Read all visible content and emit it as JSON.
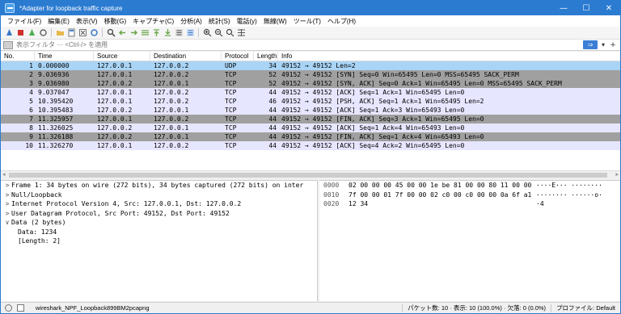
{
  "window": {
    "title": "*Adapter for loopback traffic capture",
    "minimize": "—",
    "maximize": "☐",
    "close": "✕"
  },
  "menu": [
    "ファイル(F)",
    "編集(E)",
    "表示(V)",
    "移動(G)",
    "キャプチャ(C)",
    "分析(A)",
    "統計(S)",
    "電話(y)",
    "無線(W)",
    "ツール(T)",
    "ヘルプ(H)"
  ],
  "filter": {
    "placeholder": "表示フィルタ ··· <Ctrl-/> を適用",
    "apply": "⇒",
    "dropdown": "▾",
    "add": "+"
  },
  "columns": [
    "No.",
    "Time",
    "Source",
    "Destination",
    "Protocol",
    "Length",
    "Info"
  ],
  "packets": [
    {
      "no": "1",
      "time": "0.000000",
      "src": "127.0.0.1",
      "dst": "127.0.0.2",
      "proto": "UDP",
      "len": "34",
      "info": "49152 → 49152 Len=2",
      "bg": "#a9d4f5"
    },
    {
      "no": "2",
      "time": "9.036936",
      "src": "127.0.0.1",
      "dst": "127.0.0.2",
      "proto": "TCP",
      "len": "52",
      "info": "49152 → 49152 [SYN] Seq=0 Win=65495 Len=0 MSS=65495 SACK_PERM",
      "bg": "#a0a0a0"
    },
    {
      "no": "3",
      "time": "9.036980",
      "src": "127.0.0.2",
      "dst": "127.0.0.1",
      "proto": "TCP",
      "len": "52",
      "info": "49152 → 49152 [SYN, ACK] Seq=0 Ack=1 Win=65495 Len=0 MSS=65495 SACK_PERM",
      "bg": "#a0a0a0"
    },
    {
      "no": "4",
      "time": "9.037047",
      "src": "127.0.0.1",
      "dst": "127.0.0.2",
      "proto": "TCP",
      "len": "44",
      "info": "49152 → 49152 [ACK] Seq=1 Ack=1 Win=65495 Len=0",
      "bg": "#e7e6ff"
    },
    {
      "no": "5",
      "time": "10.395420",
      "src": "127.0.0.1",
      "dst": "127.0.0.2",
      "proto": "TCP",
      "len": "46",
      "info": "49152 → 49152 [PSH, ACK] Seq=1 Ack=1 Win=65495 Len=2",
      "bg": "#e7e6ff"
    },
    {
      "no": "6",
      "time": "10.395483",
      "src": "127.0.0.2",
      "dst": "127.0.0.1",
      "proto": "TCP",
      "len": "44",
      "info": "49152 → 49152 [ACK] Seq=1 Ack=3 Win=65493 Len=0",
      "bg": "#e7e6ff"
    },
    {
      "no": "7",
      "time": "11.325957",
      "src": "127.0.0.1",
      "dst": "127.0.0.2",
      "proto": "TCP",
      "len": "44",
      "info": "49152 → 49152 [FIN, ACK] Seq=3 Ack=1 Win=65495 Len=0",
      "bg": "#a0a0a0"
    },
    {
      "no": "8",
      "time": "11.326025",
      "src": "127.0.0.2",
      "dst": "127.0.0.1",
      "proto": "TCP",
      "len": "44",
      "info": "49152 → 49152 [ACK] Seq=1 Ack=4 Win=65493 Len=0",
      "bg": "#e7e6ff"
    },
    {
      "no": "9",
      "time": "11.326188",
      "src": "127.0.0.2",
      "dst": "127.0.0.1",
      "proto": "TCP",
      "len": "44",
      "info": "49152 → 49152 [FIN, ACK] Seq=1 Ack=4 Win=65493 Len=0",
      "bg": "#a0a0a0"
    },
    {
      "no": "10",
      "time": "11.326270",
      "src": "127.0.0.1",
      "dst": "127.0.0.2",
      "proto": "TCP",
      "len": "44",
      "info": "49152 → 49152 [ACK] Seq=4 Ack=2 Win=65495 Len=0",
      "bg": "#e7e6ff"
    }
  ],
  "details": [
    {
      "expander": ">",
      "text": "Frame 1: 34 bytes on wire (272 bits), 34 bytes captured (272 bits) on inter",
      "indent": 0
    },
    {
      "expander": ">",
      "text": "Null/Loopback",
      "indent": 0
    },
    {
      "expander": ">",
      "text": "Internet Protocol Version 4, Src: 127.0.0.1, Dst: 127.0.0.2",
      "indent": 0
    },
    {
      "expander": ">",
      "text": "User Datagram Protocol, Src Port: 49152, Dst Port: 49152",
      "indent": 0
    },
    {
      "expander": "∨",
      "text": "Data (2 bytes)",
      "indent": 0
    },
    {
      "expander": "",
      "text": "Data: 1234",
      "indent": 1
    },
    {
      "expander": "",
      "text": "[Length: 2]",
      "indent": 1
    }
  ],
  "hex": [
    {
      "offset": "0000",
      "bytes": "02 00 00 00 45 00 00 1e  be 81 00 00 80 11 00 00",
      "ascii": "····E··· ········"
    },
    {
      "offset": "0010",
      "bytes": "7f 00 00 01 7f 00 00 02  c0 00 c0 00 00 0a 6f a1",
      "ascii": "········ ······o·"
    },
    {
      "offset": "0020",
      "bytes": "12 34",
      "ascii": "·4"
    }
  ],
  "status": {
    "file": "wireshark_NPF_Loopback899BM2pcapng",
    "stats": "パケット数: 10 · 表示: 10 (100.0%) · 欠落: 0 (0.0%)",
    "profile": "プロファイル: Default"
  }
}
